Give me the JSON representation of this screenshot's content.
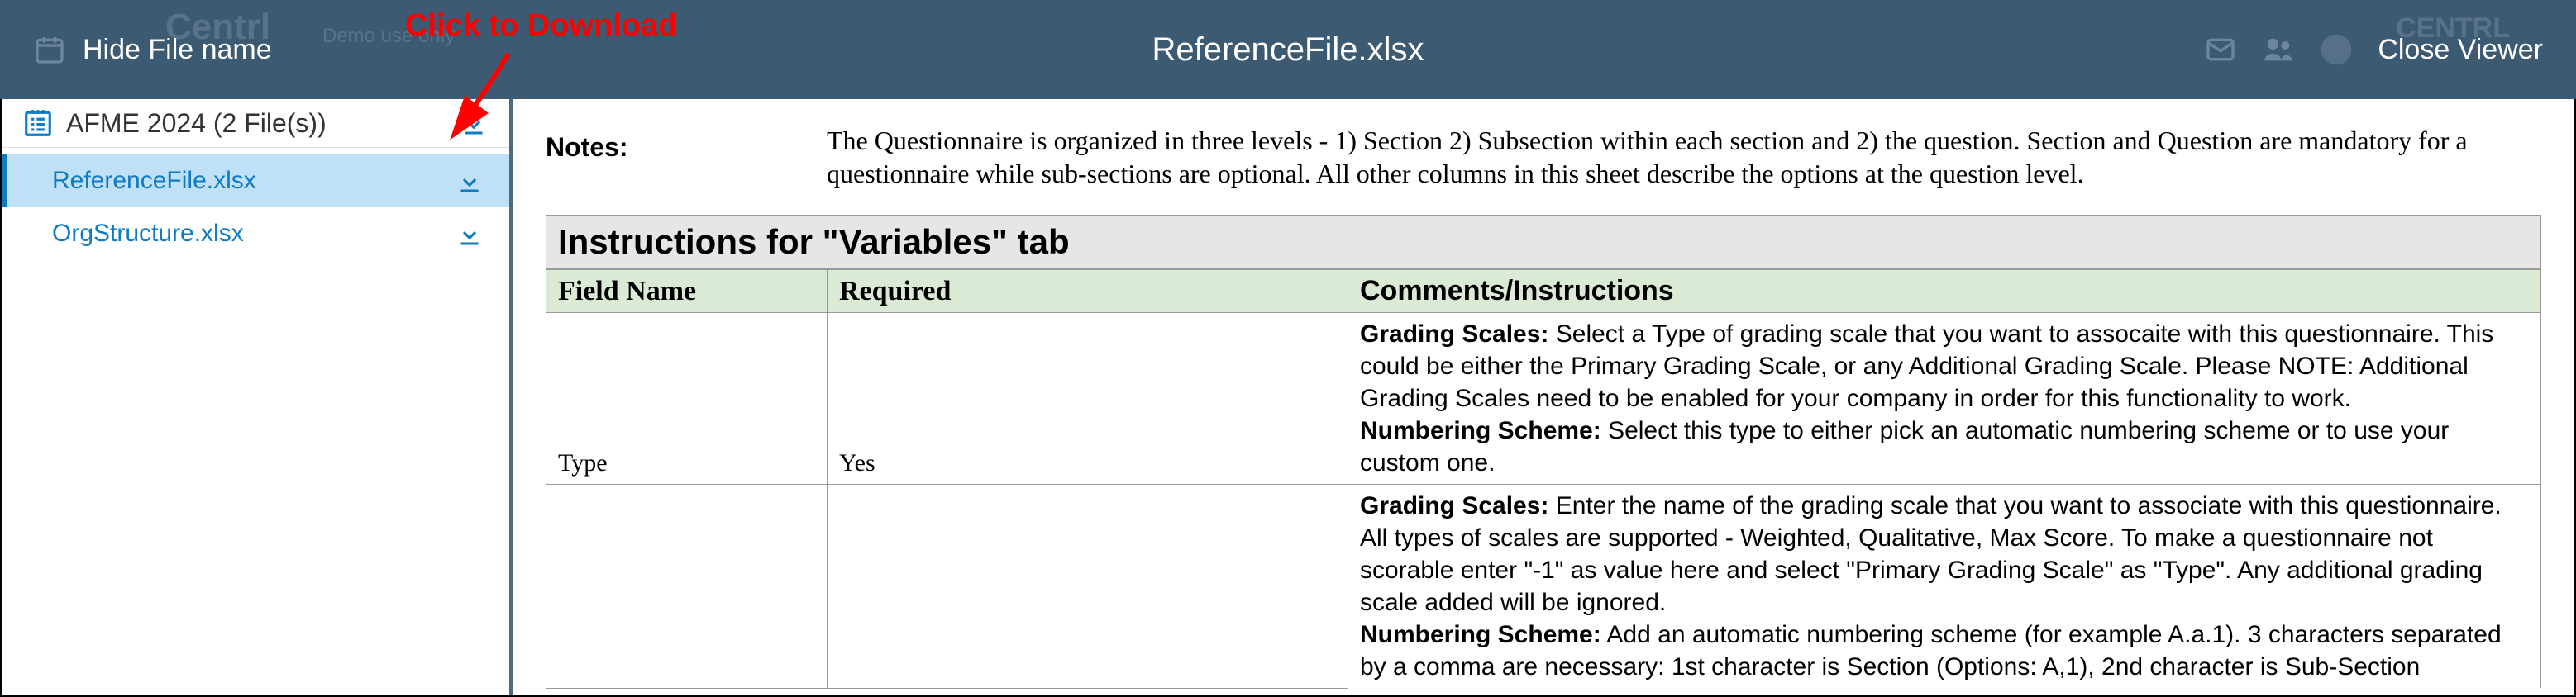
{
  "header": {
    "hide_file_name": "Hide File name",
    "title": "ReferenceFile.xlsx",
    "close_viewer": "Close Viewer",
    "brand_ghost": "Centrl",
    "demo_ghost": "Demo use only",
    "brand_right": "CENTRL"
  },
  "annotation": {
    "label": "Click to Download"
  },
  "sidebar": {
    "group_name": "AFME 2024 (2 File(s))",
    "items": [
      {
        "name": "ReferenceFile.xlsx",
        "active": true
      },
      {
        "name": "OrgStructure.xlsx",
        "active": false
      }
    ]
  },
  "content": {
    "notes_label": "Notes:",
    "notes_text": "The Questionnaire is organized in three levels - 1) Section 2) Subsection within each section and 2) the question. Section and Question are mandatory for a questionnaire while sub-sections are optional. All other columns in this sheet describe the options at the question level.",
    "section_title": "Instructions for \"Variables\" tab",
    "columns": {
      "field": "Field Name",
      "required": "Required",
      "comments": "Comments/Instructions"
    },
    "rows": [
      {
        "field": "Type",
        "required": "Yes",
        "comments_parts": {
          "gs_label": "Grading Scales:",
          "gs_text": " Select a Type of grading scale that you want to assocaite with this questionnaire. This could be either the Primary Grading Scale, or any Additional Grading Scale. Please NOTE: Additional Grading Scales need to be enabled for your company in order for this functionality to work.",
          "ns_label": "Numbering Scheme:",
          "ns_text": " Select this type to either pick an automatic numbering scheme or to use your custom one."
        }
      },
      {
        "field": "",
        "required": "",
        "comments_parts": {
          "gs_label": "Grading Scales:",
          "gs_text": " Enter the name of the grading scale that you want to associate with this questionnaire. All types of scales are supported - Weighted, Qualitative, Max Score. To make a questionnaire not scorable enter \"-1\" as value here and select \"Primary Grading Scale\" as \"Type\". Any additional grading scale added will be ignored.",
          "ns_label": "Numbering Scheme:",
          "ns_text": " Add an automatic numbering scheme (for example A.a.1). 3 characters separated by a comma are necessary: 1st character is Section (Options: A,1), 2nd character is Sub-Section"
        }
      }
    ]
  }
}
